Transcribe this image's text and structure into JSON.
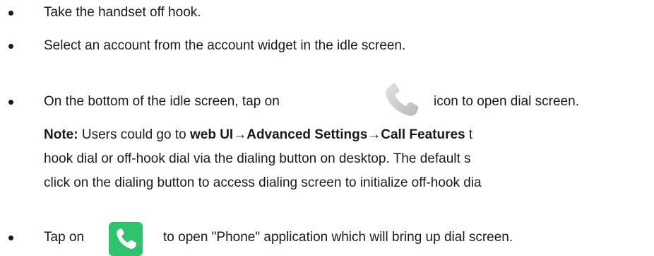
{
  "items": [
    {
      "text": "Take the handset off hook."
    },
    {
      "text": "Select an account from the account widget in the idle screen."
    },
    {
      "text_before": "On the bottom of the idle screen, tap on",
      "text_after": "icon to open dial screen.",
      "icon": "phone-handset-gray-icon"
    },
    {
      "text_before": "Tap on",
      "text_after": "to open \"Phone\" application which will bring up dial screen.",
      "icon": "phone-app-green-icon"
    }
  ],
  "note": {
    "label": "Note:",
    "line1_a": " Users could go to ",
    "line1_b": "web UI",
    "line1_arrow1": "→",
    "line1_c": "Advanced Settings",
    "line1_arrow2": "→",
    "line1_d": "Call Features",
    "line1_e": " t",
    "line2": "hook dial or off-hook dial via the dialing button on desktop. The default s",
    "line3": "click on the dialing button to access dialing screen to initialize off-hook dia"
  },
  "colors": {
    "text": "#1a1a1a",
    "green_icon_bg": "#2ec36c",
    "gray_icon": "#c8c8c8"
  }
}
